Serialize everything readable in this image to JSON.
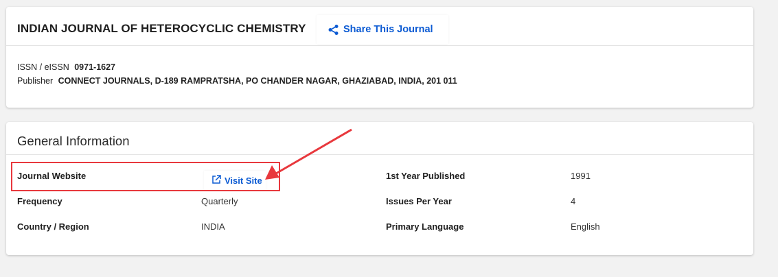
{
  "journal": {
    "title": "INDIAN JOURNAL OF HETEROCYCLIC CHEMISTRY",
    "share_label": "Share This Journal",
    "issn_label": "ISSN / eISSN",
    "issn_value": "0971-1627",
    "publisher_label": "Publisher",
    "publisher_value": "CONNECT JOURNALS, D-189 RAMPRATSHA, PO CHANDER NAGAR, GHAZIABAD, INDIA, 201 011"
  },
  "general": {
    "title": "General Information",
    "website_label": "Journal Website",
    "visit_label": "Visit Site",
    "first_year_label": "1st Year Published",
    "first_year_value": "1991",
    "frequency_label": "Frequency",
    "frequency_value": "Quarterly",
    "issues_label": "Issues Per Year",
    "issues_value": "4",
    "country_label": "Country / Region",
    "country_value": "INDIA",
    "language_label": "Primary Language",
    "language_value": "English"
  },
  "colors": {
    "link": "#0c5bd3",
    "annotation": "#e8383d"
  },
  "icons": {
    "share": "share-icon",
    "external": "external-link-icon"
  }
}
